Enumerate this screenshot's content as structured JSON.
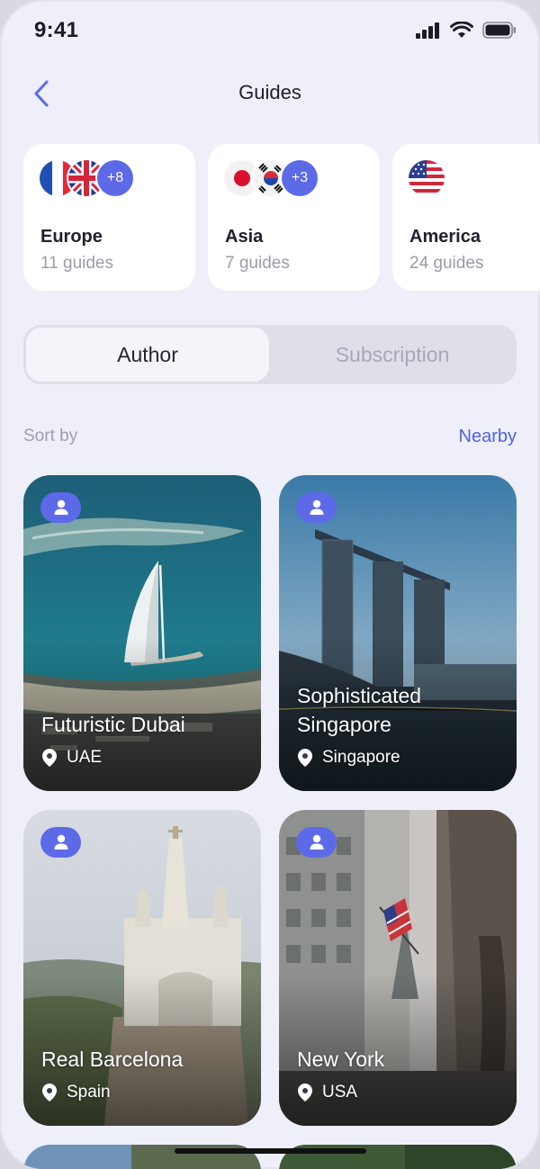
{
  "status": {
    "time": "9:41"
  },
  "header": {
    "title": "Guides"
  },
  "regions": [
    {
      "name": "Europe",
      "count": "11 guides",
      "more": "+8"
    },
    {
      "name": "Asia",
      "count": "7 guides",
      "more": "+3"
    },
    {
      "name": "America",
      "count": "24 guides"
    }
  ],
  "tabs": {
    "author": "Author",
    "subscription": "Subscription"
  },
  "sort": {
    "label": "Sort by",
    "value": "Nearby"
  },
  "guides": [
    {
      "title": "Futuristic Dubai",
      "location": "UAE"
    },
    {
      "title": "Sophisticated Singapore",
      "location": "Singapore"
    },
    {
      "title": "Real Barcelona",
      "location": "Spain"
    },
    {
      "title": "New York",
      "location": "USA"
    }
  ],
  "colors": {
    "accent": "#5d6ae8",
    "link": "#5262e0",
    "background": "#eeeff8",
    "card": "#ffffff"
  }
}
